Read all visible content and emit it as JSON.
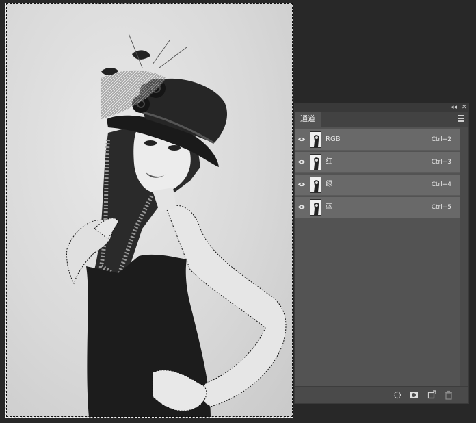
{
  "panel": {
    "collapse_glyph": "◂◂",
    "close_glyph": "✕",
    "tab_label": "通道",
    "menu_icon": "panel-menu-icon",
    "channels": [
      {
        "name": "RGB",
        "shortcut": "Ctrl+2",
        "visible": true
      },
      {
        "name": "红",
        "shortcut": "Ctrl+3",
        "visible": true
      },
      {
        "name": "绿",
        "shortcut": "Ctrl+4",
        "visible": true
      },
      {
        "name": "蓝",
        "shortcut": "Ctrl+5",
        "visible": true
      }
    ],
    "footer_icons": [
      "load-selection-icon",
      "save-selection-icon",
      "new-channel-icon",
      "delete-channel-icon"
    ]
  },
  "document": {
    "mode": "grayscale-photo",
    "selection_active": true
  },
  "colors": {
    "workspace": "#282828",
    "panel_bg": "#535353",
    "row_bg": "#696969",
    "text": "#e8e8e8"
  }
}
